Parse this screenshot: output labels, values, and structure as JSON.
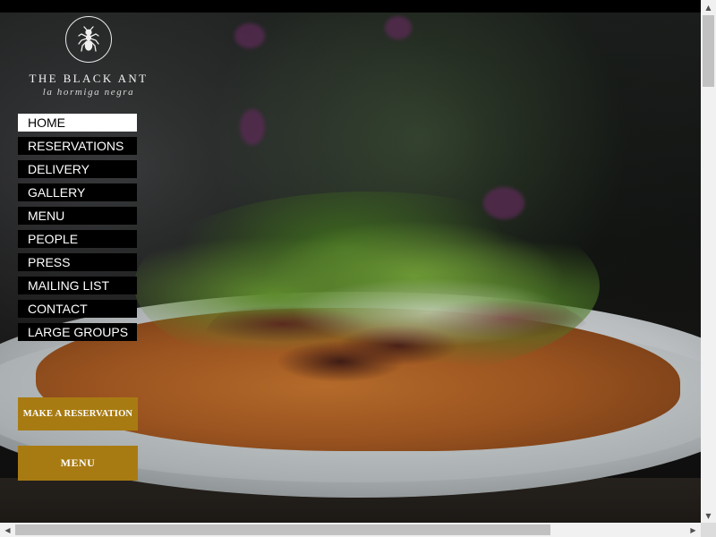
{
  "brand": {
    "title": "THE BLACK ANT",
    "subtitle": "la hormiga negra",
    "logo_icon": "ant-icon"
  },
  "nav": {
    "items": [
      {
        "label": "HOME",
        "active": true
      },
      {
        "label": "RESERVATIONS",
        "active": false
      },
      {
        "label": "DELIVERY",
        "active": false
      },
      {
        "label": "GALLERY",
        "active": false
      },
      {
        "label": "MENU",
        "active": false
      },
      {
        "label": "PEOPLE",
        "active": false
      },
      {
        "label": "PRESS",
        "active": false
      },
      {
        "label": "MAILING LIST",
        "active": false
      },
      {
        "label": "CONTACT",
        "active": false
      },
      {
        "label": "LARGE GROUPS",
        "active": false
      }
    ]
  },
  "cta": {
    "reserve_label": "MAKE A RESERVATION",
    "menu_label": "MENU"
  },
  "colors": {
    "accent_gold": "#a87b12",
    "nav_bg": "#000000",
    "nav_active_bg": "#ffffff"
  },
  "scrollbars": {
    "up_icon": "arrow-up-icon",
    "down_icon": "arrow-down-icon",
    "left_icon": "arrow-left-icon",
    "right_icon": "arrow-right-icon"
  }
}
